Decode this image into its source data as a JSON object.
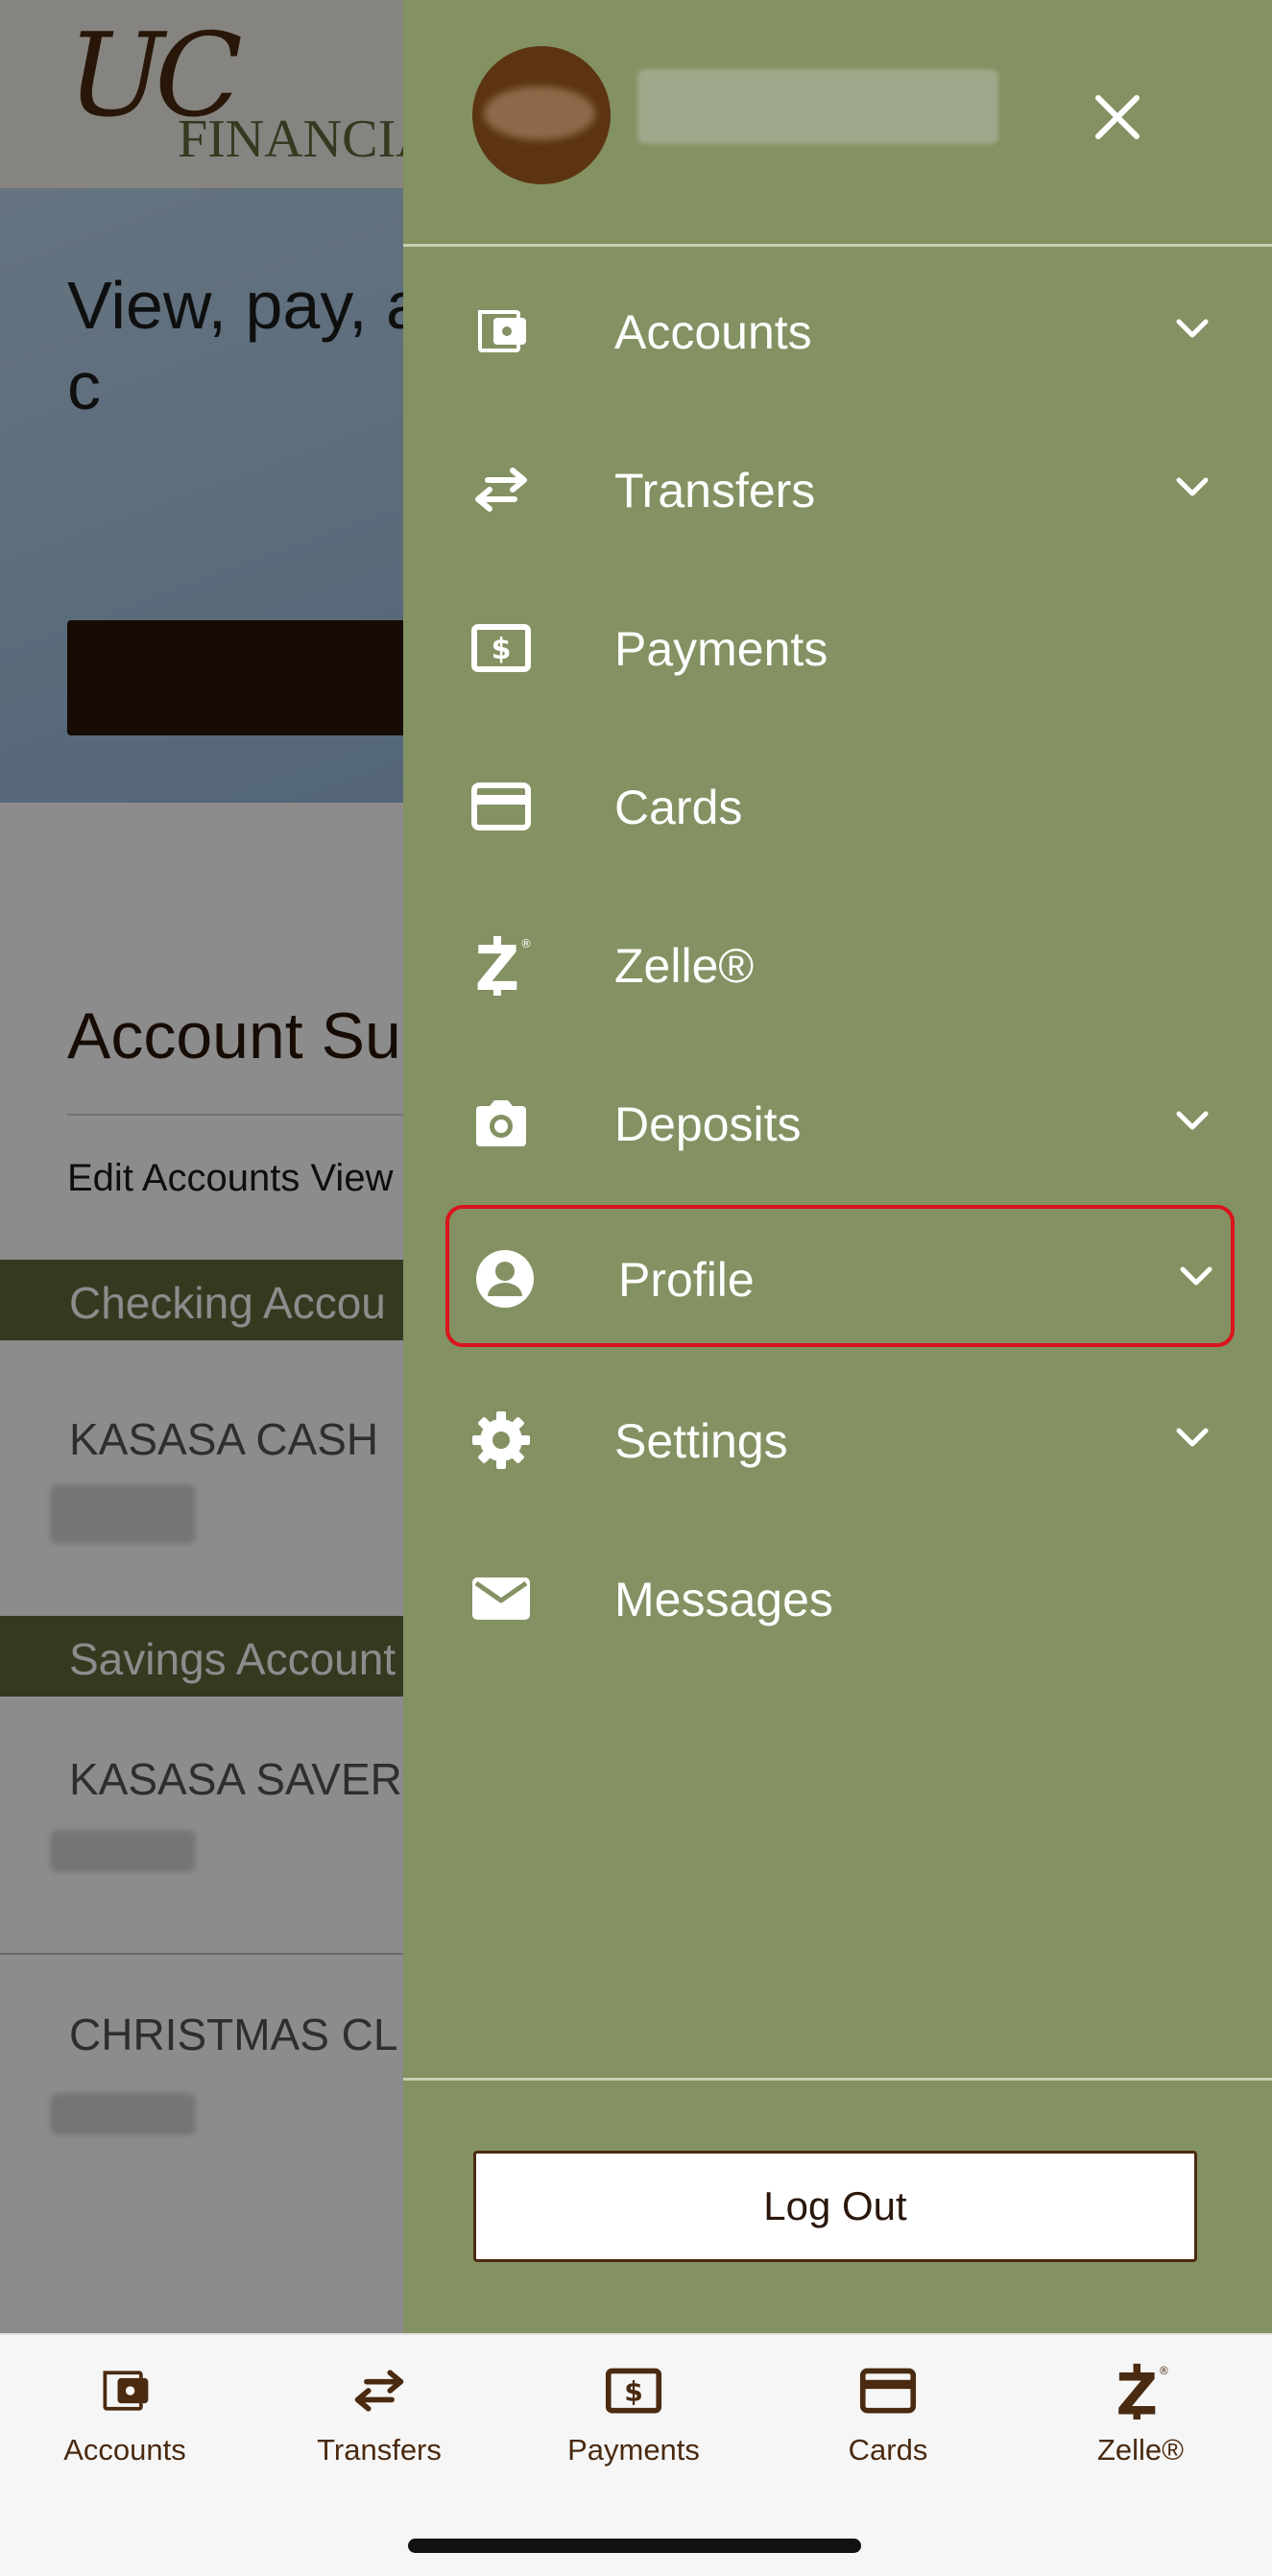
{
  "background": {
    "logo": {
      "mark": "UC",
      "text": "FINANCIAL"
    },
    "hero": {
      "text": "View, pay, and and debit c"
    },
    "summary": {
      "title": "Account Su",
      "edit_link": "Edit Accounts View",
      "groups": [
        {
          "title": "Checking Accou",
          "accounts": [
            {
              "name": "KASASA CASH"
            }
          ]
        },
        {
          "title": "Savings Account",
          "accounts": [
            {
              "name": "KASASA SAVER"
            },
            {
              "name": "CHRISTMAS CL"
            }
          ]
        }
      ]
    }
  },
  "drawer": {
    "close_icon": "close-icon",
    "items": [
      {
        "label": "Accounts",
        "icon": "wallet-icon",
        "expandable": true
      },
      {
        "label": "Transfers",
        "icon": "transfer-arrows-icon",
        "expandable": true
      },
      {
        "label": "Payments",
        "icon": "payment-bill-icon",
        "expandable": false
      },
      {
        "label": "Cards",
        "icon": "credit-card-icon",
        "expandable": false
      },
      {
        "label": "Zelle®",
        "icon": "zelle-icon",
        "expandable": false
      },
      {
        "label": "Deposits",
        "icon": "camera-icon",
        "expandable": true
      },
      {
        "label": "Profile",
        "icon": "user-circle-icon",
        "expandable": true,
        "highlighted": true
      },
      {
        "label": "Settings",
        "icon": "gear-icon",
        "expandable": true
      },
      {
        "label": "Messages",
        "icon": "envelope-icon",
        "expandable": false
      }
    ],
    "logout_label": "Log Out"
  },
  "tabbar": {
    "tabs": [
      {
        "label": "Accounts",
        "icon": "wallet-icon"
      },
      {
        "label": "Transfers",
        "icon": "transfer-arrows-icon"
      },
      {
        "label": "Payments",
        "icon": "payment-bill-icon"
      },
      {
        "label": "Cards",
        "icon": "credit-card-icon"
      },
      {
        "label": "Zelle®",
        "icon": "zelle-icon"
      }
    ]
  },
  "colors": {
    "drawer_bg": "#849162",
    "brand_brown": "#4a2a10",
    "brand_olive": "#5d6b3b",
    "highlight": "#d9141c"
  }
}
